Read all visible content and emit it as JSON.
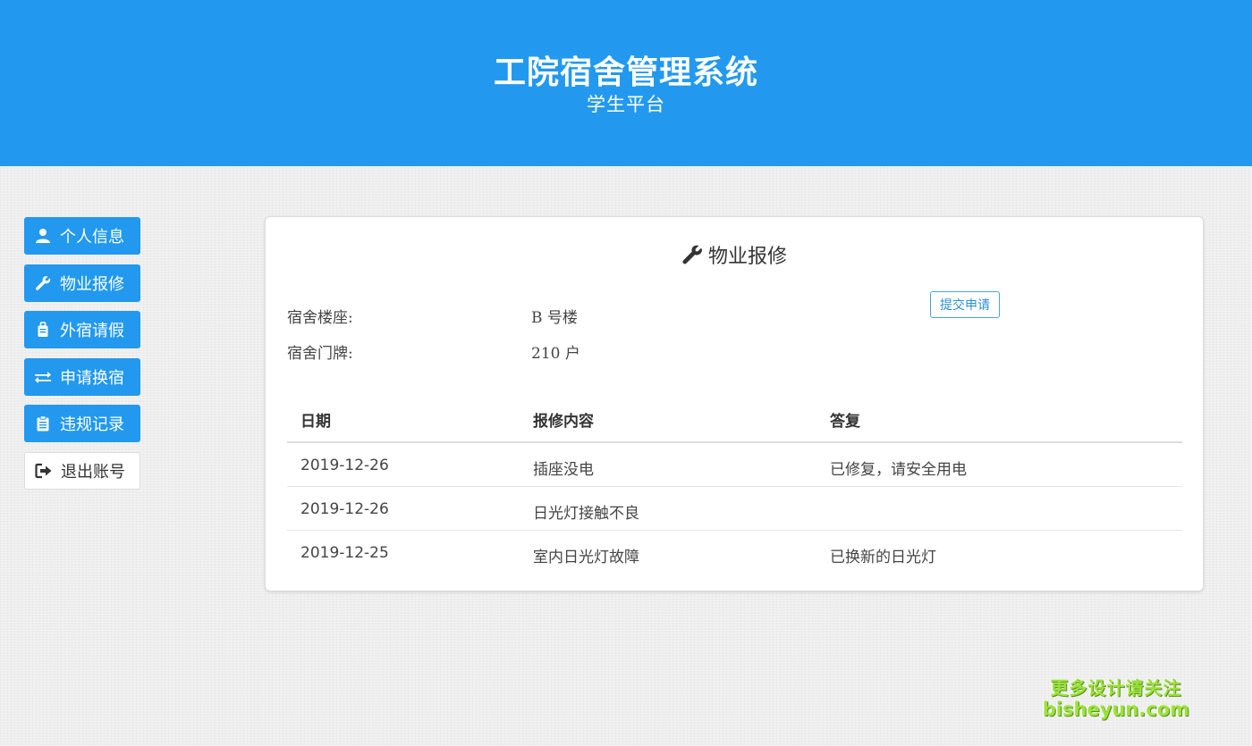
{
  "header": {
    "title": "工院宿舍管理系统",
    "subtitle": "学生平台"
  },
  "sidebar": {
    "items": [
      {
        "label": "个人信息",
        "icon": "user-icon"
      },
      {
        "label": "物业报修",
        "icon": "wrench-icon"
      },
      {
        "label": "外宿请假",
        "icon": "suitcase-icon"
      },
      {
        "label": "申请换宿",
        "icon": "exchange-icon"
      },
      {
        "label": "违规记录",
        "icon": "clipboard-icon"
      },
      {
        "label": "退出账号",
        "icon": "sign-out-icon"
      }
    ]
  },
  "panel": {
    "title": "物业报修",
    "building_label": "宿舍楼座:",
    "building_value": "B 号楼",
    "room_label": "宿舍门牌:",
    "room_value": "210 户",
    "submit_label": "提交申请",
    "table": {
      "headers": [
        "日期",
        "报修内容",
        "答复"
      ],
      "rows": [
        {
          "date": "2019-12-26",
          "content": "插座没电",
          "reply": "已修复，请安全用电"
        },
        {
          "date": "2019-12-26",
          "content": "日光灯接触不良",
          "reply": ""
        },
        {
          "date": "2019-12-25",
          "content": "室内日光灯故障",
          "reply": "已换新的日光灯"
        }
      ]
    }
  },
  "watermark": {
    "line1": "更多设计请关注",
    "line2": "bisheyun.com"
  },
  "colors": {
    "primary": "#2299ee",
    "watermark": "#9be33a"
  }
}
